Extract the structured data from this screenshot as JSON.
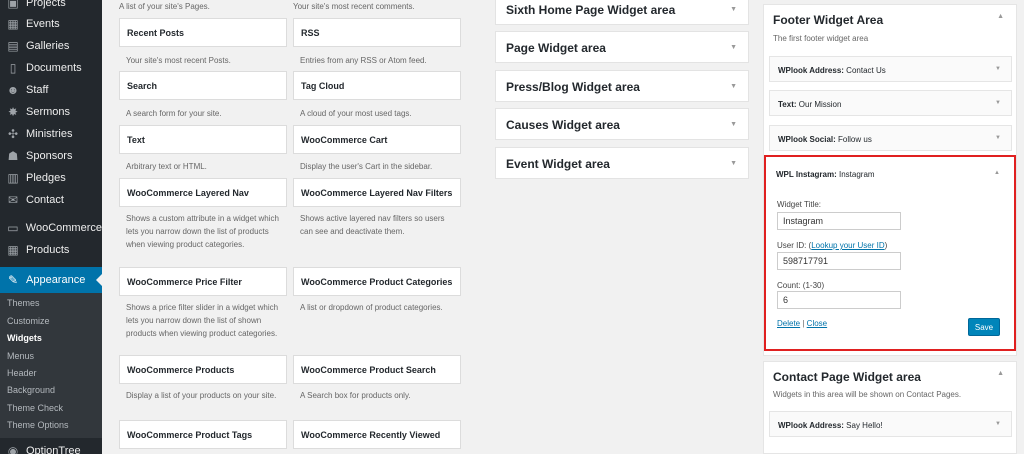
{
  "sidebar": {
    "items": [
      {
        "label": "Projects",
        "icon": "projects-icon"
      },
      {
        "label": "Events",
        "icon": "events-icon"
      },
      {
        "label": "Galleries",
        "icon": "galleries-icon"
      },
      {
        "label": "Documents",
        "icon": "documents-icon"
      },
      {
        "label": "Staff",
        "icon": "staff-icon"
      },
      {
        "label": "Sermons",
        "icon": "sermons-icon"
      },
      {
        "label": "Ministries",
        "icon": "ministries-icon"
      },
      {
        "label": "Sponsors",
        "icon": "sponsors-icon"
      },
      {
        "label": "Pledges",
        "icon": "pledges-icon"
      },
      {
        "label": "Contact",
        "icon": "contact-icon"
      },
      {
        "label": "WooCommerce",
        "icon": "woocommerce-icon"
      },
      {
        "label": "Products",
        "icon": "products-icon"
      },
      {
        "label": "Appearance",
        "icon": "appearance-icon"
      },
      {
        "label": "OptionTree",
        "icon": "optiontree-icon"
      }
    ],
    "submenu": [
      "Themes",
      "Customize",
      "Widgets",
      "Menus",
      "Header",
      "Background",
      "Theme Check",
      "Theme Options"
    ]
  },
  "available_widgets": {
    "top_left_desc": "A list of your site's Pages.",
    "top_right_desc": "Your site's most recent comments.",
    "rows": [
      {
        "left_title": "Recent Posts",
        "left_desc": "Your site's most recent Posts.",
        "right_title": "RSS",
        "right_desc": "Entries from any RSS or Atom feed."
      },
      {
        "left_title": "Search",
        "left_desc": "A search form for your site.",
        "right_title": "Tag Cloud",
        "right_desc": "A cloud of your most used tags."
      },
      {
        "left_title": "Text",
        "left_desc": "Arbitrary text or HTML.",
        "right_title": "WooCommerce Cart",
        "right_desc": "Display the user's Cart in the sidebar."
      },
      {
        "left_title": "WooCommerce Layered Nav",
        "left_desc": "Shows a custom attribute in a widget which lets you narrow down the list of products when viewing product categories.",
        "right_title": "WooCommerce Layered Nav Filters",
        "right_desc": "Shows active layered nav filters so users can see and deactivate them."
      },
      {
        "left_title": "WooCommerce Price Filter",
        "left_desc": "Shows a price filter slider in a widget which lets you narrow down the list of shown products when viewing product categories.",
        "right_title": "WooCommerce Product Categories",
        "right_desc": "A list or dropdown of product categories."
      },
      {
        "left_title": "WooCommerce Products",
        "left_desc": "Display a list of your products on your site.",
        "right_title": "WooCommerce Product Search",
        "right_desc": "A Search box for products only."
      },
      {
        "left_title": "WooCommerce Product Tags",
        "left_desc": "",
        "right_title": "WooCommerce Recently Viewed",
        "right_desc": ""
      }
    ]
  },
  "middle_areas": [
    "Sixth Home Page Widget area",
    "Page Widget area",
    "Press/Blog Widget area",
    "Causes Widget area",
    "Event Widget area"
  ],
  "footer_area": {
    "title": "Footer Widget Area",
    "desc": "The first footer widget area",
    "widgets": [
      {
        "type": "WPlook Address:",
        "name": "Contact Us"
      },
      {
        "type": "Text:",
        "name": "Our Mission"
      },
      {
        "type": "WPlook Social:",
        "name": "Follow us"
      }
    ],
    "instagram": {
      "type": "WPL Instagram:",
      "name": "Instagram",
      "title_label": "Widget Title:",
      "title_value": "Instagram",
      "userid_label": "User ID: (",
      "userid_link": "Lookup your User ID",
      "userid_close": ")",
      "userid_value": "598717791",
      "count_label": "Count: (1-30)",
      "count_value": "6",
      "delete": "Delete",
      "separator": "|",
      "close": "Close",
      "save": "Save"
    }
  },
  "contact_area": {
    "title": "Contact Page Widget area",
    "desc": "Widgets in this area will be shown on Contact Pages.",
    "widget": {
      "type": "WPlook Address:",
      "name": "Say Hello!"
    }
  },
  "colors": {
    "accent": "#0073aa",
    "sidebar_bg": "#23282d",
    "highlight_border": "#e02020"
  }
}
